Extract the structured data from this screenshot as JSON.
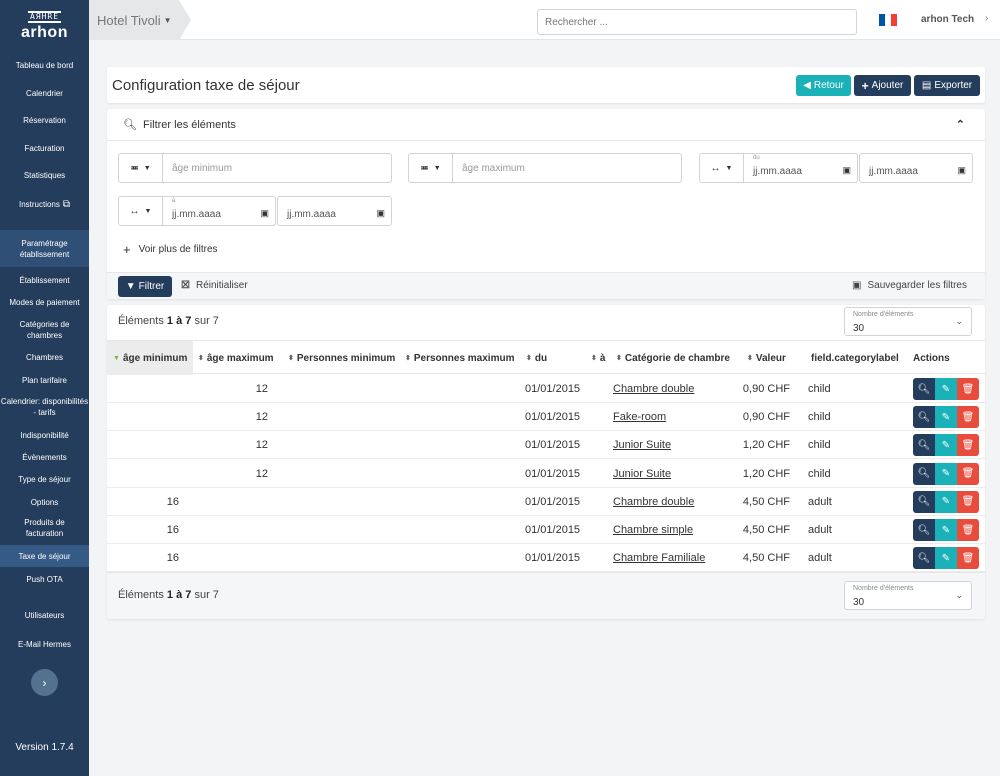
{
  "sidebar": {
    "logo_mark": "AЯHRE",
    "logo_word": "arhon",
    "items": [
      {
        "label": "Tableau de bord"
      },
      {
        "label": "Calendrier"
      },
      {
        "label": "Réservation"
      },
      {
        "label": "Facturation"
      },
      {
        "label": "Statistiques"
      },
      {
        "label": "Instructions"
      },
      {
        "label": "Paramétrage établissement"
      },
      {
        "label": "Établissement"
      },
      {
        "label": "Modes de paiement"
      },
      {
        "label": "Catégories de chambres"
      },
      {
        "label": "Chambres"
      },
      {
        "label": "Plan tarifaire"
      },
      {
        "label": "Calendrier: disponibilités - tarifs"
      },
      {
        "label": "Indisponibilité"
      },
      {
        "label": "Évènements"
      },
      {
        "label": "Type de séjour"
      },
      {
        "label": "Options"
      },
      {
        "label": "Produits de facturation"
      },
      {
        "label": "Taxe de séjour"
      },
      {
        "label": "Push OTA"
      },
      {
        "label": "Utilisateurs"
      },
      {
        "label": "E-Mail Hermes"
      }
    ],
    "version": "Version 1.7.4"
  },
  "topbar": {
    "hotel": "Hotel Tivoli",
    "search_placeholder": "Rechercher ...",
    "user": "arhon Tech",
    "flag_colors": [
      "#0055a4",
      "#ffffff",
      "#ef4135"
    ]
  },
  "page": {
    "title": "Configuration taxe de séjour",
    "btn_retour": "Retour",
    "btn_ajouter": "Ajouter",
    "btn_exporter": "Exporter"
  },
  "filters": {
    "title": "Filtrer les éléments",
    "age_min_placeholder": "âge minimum",
    "age_max_placeholder": "âge maximum",
    "date_placeholder": "jj.mm.aaaa",
    "du_label": "du",
    "a_label": "à",
    "more": "Voir plus de filtres",
    "filter_btn": "Filtrer",
    "reset": "Réinitialiser",
    "save": "Sauvegarder les filtres"
  },
  "table": {
    "count_prefix": "Éléments",
    "count_range": "1 à 7",
    "count_suffix": "sur 7",
    "page_size_label": "Nombre d'éléments",
    "page_size_value": "30",
    "headers": {
      "age_min": "âge minimum",
      "age_max": "âge maximum",
      "pers_min": "Personnes minimum",
      "pers_max": "Personnes maximum",
      "du": "du",
      "a": "à",
      "category": "Catégorie de chambre",
      "value": "Valeur",
      "catlabel": "field.categorylabel",
      "actions": "Actions"
    },
    "rows": [
      {
        "age_min": "",
        "age_max": "12",
        "du": "01/01/2015",
        "category": "Chambre double",
        "value": "0,90 CHF",
        "catlabel": "child"
      },
      {
        "age_min": "",
        "age_max": "12",
        "du": "01/01/2015",
        "category": "Fake-room",
        "value": "0,90 CHF",
        "catlabel": "child"
      },
      {
        "age_min": "",
        "age_max": "12",
        "du": "01/01/2015",
        "category": "Junior Suite",
        "value": "1,20 CHF",
        "catlabel": "child"
      },
      {
        "age_min": "",
        "age_max": "12",
        "du": "01/01/2015",
        "category": "Junior Suite",
        "value": "1,20 CHF",
        "catlabel": "child"
      },
      {
        "age_min": "16",
        "age_max": "",
        "du": "01/01/2015",
        "category": "Chambre double",
        "value": "4,50 CHF",
        "catlabel": "adult"
      },
      {
        "age_min": "16",
        "age_max": "",
        "du": "01/01/2015",
        "category": "Chambre simple",
        "value": "4,50 CHF",
        "catlabel": "adult"
      },
      {
        "age_min": "16",
        "age_max": "",
        "du": "01/01/2015",
        "category": "Chambre Familiale",
        "value": "4,50 CHF",
        "catlabel": "adult"
      }
    ]
  },
  "colors": {
    "navy": "#243d5c",
    "teal": "#1ab2b8",
    "danger": "#e74c3c"
  }
}
